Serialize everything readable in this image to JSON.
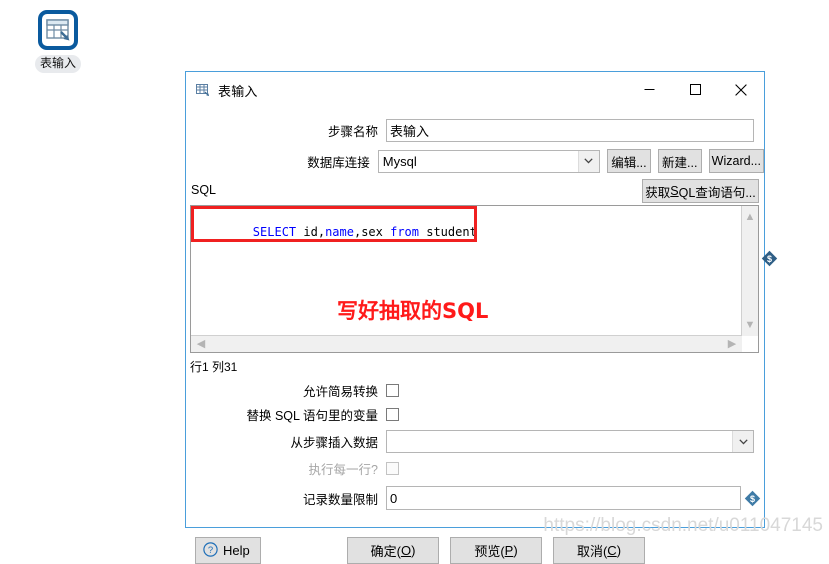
{
  "desktop": {
    "icon": {
      "name": "table-input-step-icon",
      "label": "表输入"
    }
  },
  "dialog": {
    "title": "表输入",
    "titlebar_icon": "table-icon",
    "window_controls": {
      "minimize": "—",
      "maximize": "□",
      "close": "✕"
    },
    "fields": {
      "step_name": {
        "label": "步骤名称",
        "value": "表输入"
      },
      "db_connection": {
        "label": "数据库连接",
        "value": "Mysql",
        "options": [
          "Mysql"
        ]
      }
    },
    "connection_buttons": {
      "edit": "编辑...",
      "edit_accel": "编辑",
      "new": "新建...",
      "new_accel": "新建",
      "wizard": "Wizard..."
    },
    "get_sql_button": {
      "prefix": "获取",
      "accel": "S",
      "suffix": "QL查询语句..."
    },
    "sql": {
      "section_label": "SQL",
      "tokens": [
        {
          "text": "SELECT",
          "kind": "keyword"
        },
        {
          "text": " id,",
          "kind": "plain"
        },
        {
          "text": "name",
          "kind": "keyword"
        },
        {
          "text": ",sex ",
          "kind": "plain"
        },
        {
          "text": "from",
          "kind": "keyword"
        },
        {
          "text": " student",
          "kind": "plain"
        }
      ],
      "plain_text": "SELECT id,name,sex from student",
      "annotation": "写好抽取的SQL",
      "annotation_color": "#ff1a1a",
      "caret_status": "行1 列31"
    },
    "options": {
      "allow_simple_conversion": {
        "label": "允许简易转换",
        "checked": false,
        "enabled": true
      },
      "replace_variables": {
        "label": "替换 SQL 语句里的变量",
        "checked": false,
        "enabled": true
      },
      "insert_data_from_step": {
        "label": "从步骤插入数据",
        "value": "",
        "options": []
      },
      "execute_each_row": {
        "label": "执行每一行?",
        "checked": false,
        "enabled": false
      },
      "row_limit": {
        "label": "记录数量限制",
        "value": "0"
      }
    },
    "footer": {
      "help": "Help",
      "ok": "确定(O)",
      "ok_accel": "O",
      "ok_prefix": "确定(",
      "ok_suffix": ")",
      "preview": "预览(P)",
      "preview_accel": "P",
      "preview_prefix": "预览(",
      "preview_suffix": ")",
      "cancel": "取消(C)",
      "cancel_accel": "C",
      "cancel_prefix": "取消(",
      "cancel_suffix": ")"
    }
  },
  "watermark": "https://blog.csdn.net/u011047145",
  "colors": {
    "accent_border": "#4a9edb",
    "keyword": "#0000ff",
    "annotation_red": "#ff1a1a",
    "button_face": "#e1e1e1"
  }
}
